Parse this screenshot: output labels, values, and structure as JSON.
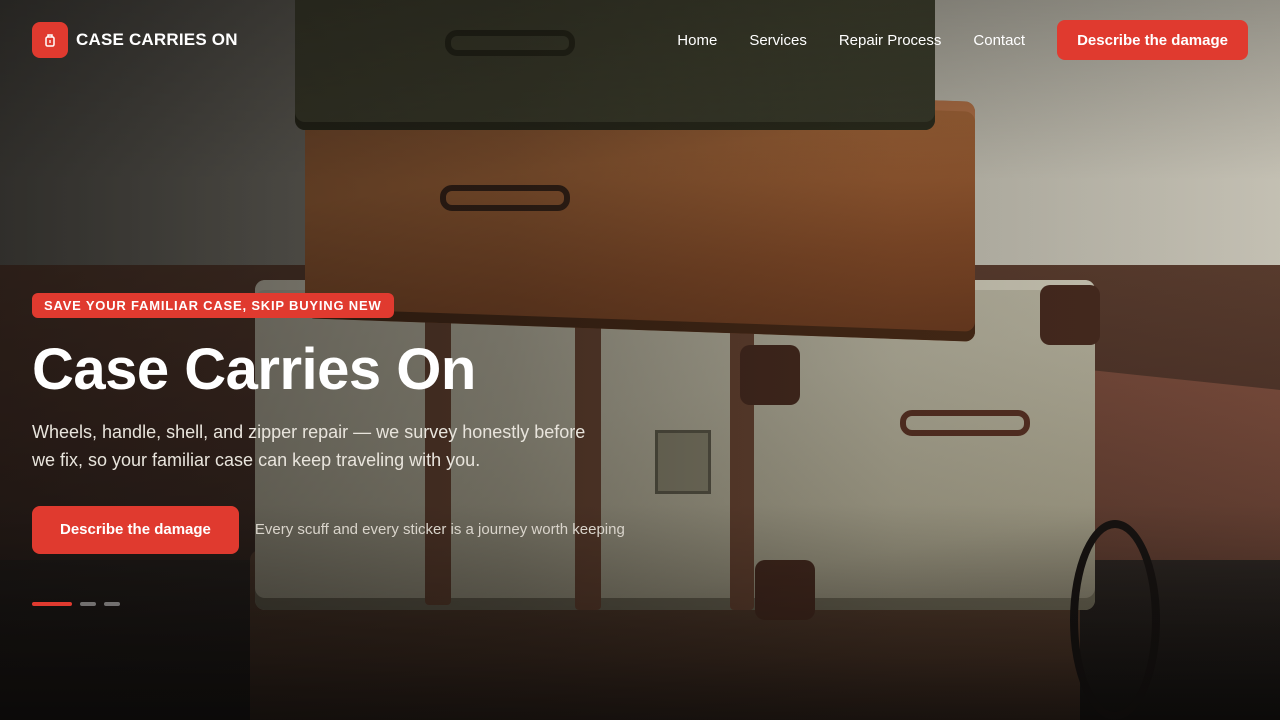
{
  "brand": {
    "name": "CASE CARRIES ON",
    "icon": "luggage-icon",
    "accent_color": "#e03a2f"
  },
  "nav": {
    "items": [
      {
        "label": "Home"
      },
      {
        "label": "Services"
      },
      {
        "label": "Repair Process"
      },
      {
        "label": "Contact"
      }
    ],
    "cta_label": "Describe the damage"
  },
  "hero": {
    "eyebrow": "SAVE YOUR FAMILIAR CASE, SKIP BUYING NEW",
    "title": "Case Carries On",
    "subtitle": "Wheels, handle, shell, and zipper repair — we survey honestly before we fix, so your familiar case can keep traveling with you.",
    "cta_label": "Describe the damage",
    "tagline": "Every scuff and every sticker is a journey worth keeping",
    "slider": {
      "count": 3,
      "active_index": 0
    }
  },
  "background": {
    "subject": "stack of vintage suitcases"
  }
}
